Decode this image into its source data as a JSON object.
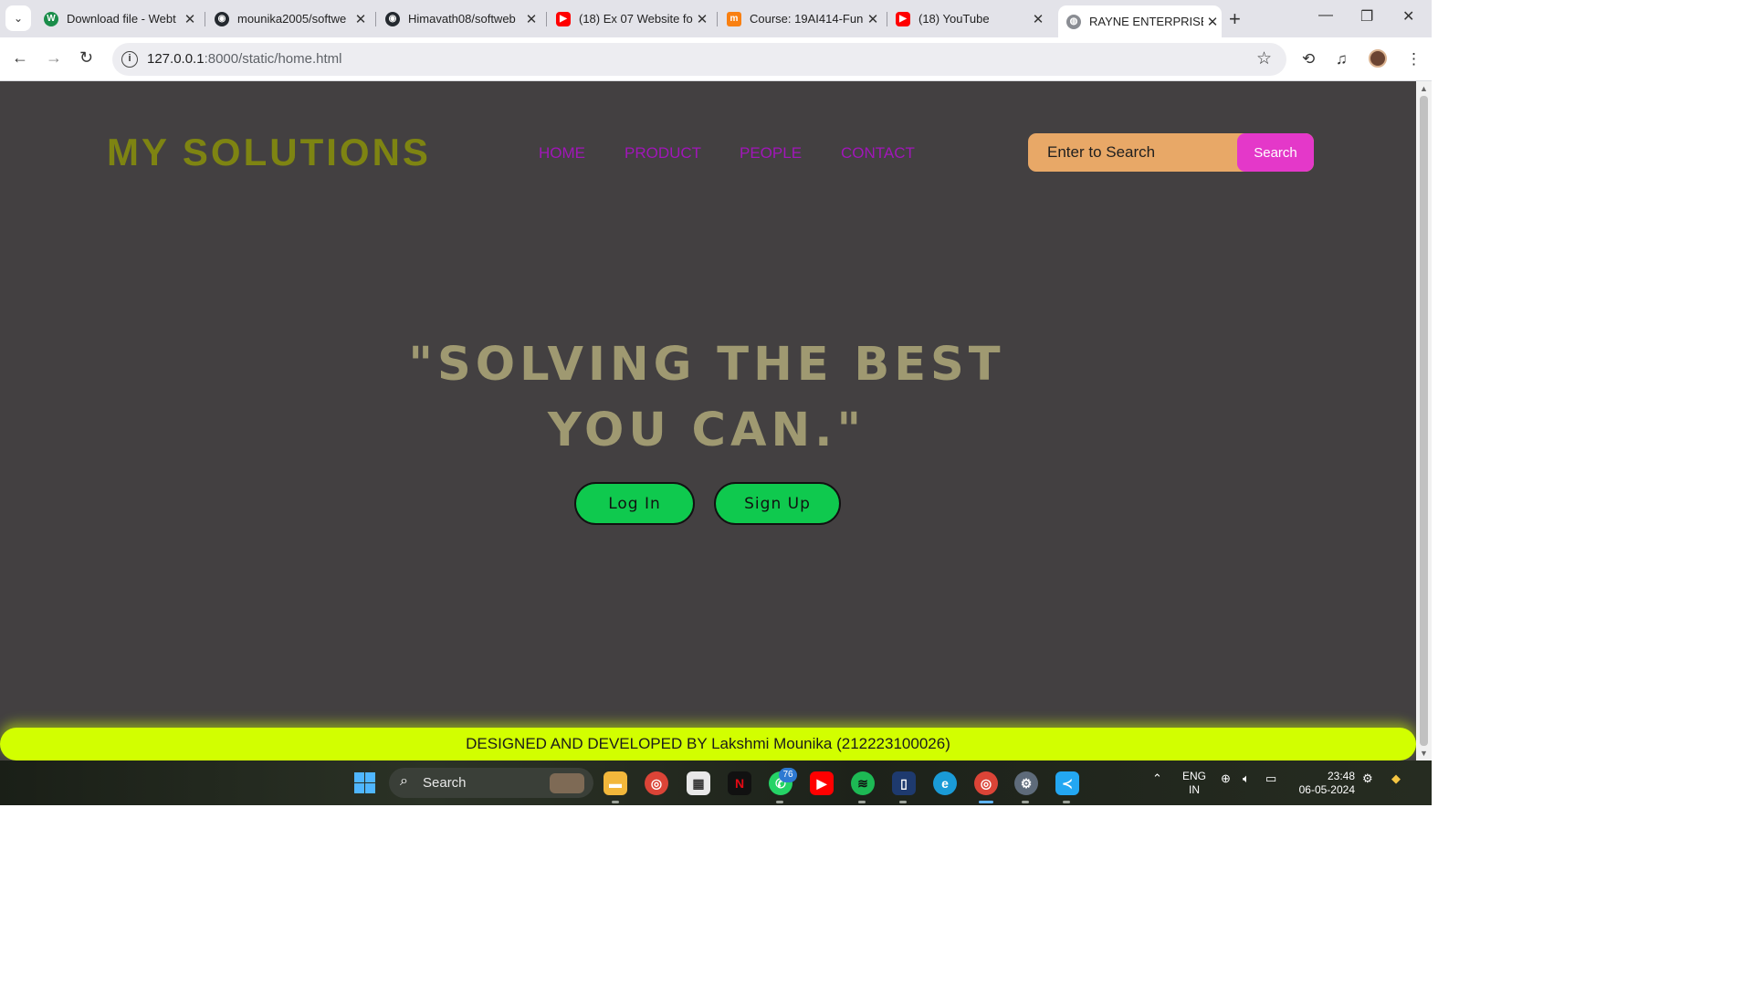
{
  "browser": {
    "tabs": [
      {
        "title": "Download file - Webt",
        "icon": "w-icon",
        "color": "#1a8d4a",
        "active": false
      },
      {
        "title": "mounika2005/softwe",
        "icon": "github-icon",
        "color": "#24292f",
        "active": false
      },
      {
        "title": "Himavath08/softweb",
        "icon": "github-icon",
        "color": "#24292f",
        "active": false
      },
      {
        "title": "(18) Ex 07 Website fo",
        "icon": "youtube-icon",
        "color": "#ff0000",
        "active": false
      },
      {
        "title": "Course: 19AI414-Fun",
        "icon": "moodle-icon",
        "color": "#f98012",
        "active": false
      },
      {
        "title": "(18) YouTube",
        "icon": "youtube-icon",
        "color": "#ff0000",
        "active": false
      },
      {
        "title": "RAYNE ENTERPRISES",
        "icon": "globe-icon",
        "color": "#5f6368",
        "active": true
      }
    ],
    "address": {
      "host": "127.0.0.1",
      "path": ":8000/static/home.html"
    }
  },
  "page": {
    "brand": "MY SOLUTIONS",
    "nav": [
      "HOME",
      "PRODUCT",
      "PEOPLE",
      "CONTACT"
    ],
    "search": {
      "placeholder": "Enter to Search",
      "button": "Search"
    },
    "hero_line1": "\"SOLVING THE BEST",
    "hero_line2": "YOU CAN.\"",
    "login": "Log In",
    "signup": "Sign Up",
    "footer": "DESIGNED AND DEVELOPED BY Lakshmi Mounika (212223100026)",
    "colors": {
      "background": "#434041",
      "brand": "#7e8412",
      "nav": "#a116b9",
      "search_field": "#e8a867",
      "search_button": "#e438c9",
      "hero": "#9f9971",
      "action_button": "#0fc94e",
      "footer": "#d2ff00"
    }
  },
  "taskbar": {
    "search_label": "Search",
    "whatsapp_badge": "76",
    "lang_line1": "ENG",
    "lang_line2": "IN",
    "time": "23:48",
    "date": "06-05-2024"
  }
}
